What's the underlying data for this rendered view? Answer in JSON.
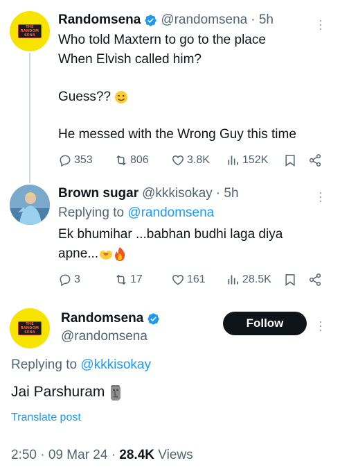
{
  "tweet1": {
    "name": "Randomsena",
    "handle": "@randomsena",
    "time": "· 5h",
    "avatar_text": [
      "THE",
      "RANDOM",
      "SENA"
    ],
    "lines": [
      "Who told Maxtern to go to the place",
      "When Elvish called him?",
      "",
      "Guess??",
      "",
      "He messed with the Wrong Guy this time"
    ],
    "emoji": "wink",
    "stats": {
      "replies": "353",
      "retweets": "806",
      "likes": "3.8K",
      "views": "152K"
    }
  },
  "tweet2": {
    "name": "Brown sugar",
    "handle": "@kkkisokay",
    "time": "· 5h",
    "replying_prefix": "Replying to ",
    "replying_to": "@randomsena",
    "line1": "Ek bhumihar ...babhan budhi laga diya",
    "line2": "apne...",
    "emojis": [
      "heart-hands",
      "fire"
    ],
    "stats": {
      "replies": "3",
      "retweets": "17",
      "likes": "161",
      "views": "28.5K"
    }
  },
  "main": {
    "name": "Randomsena",
    "handle": "@randomsena",
    "follow_label": "Follow",
    "replying_prefix": "Replying to ",
    "replying_to": "@kkkisokay",
    "text": "Jai Parshuram",
    "emoji": "moai",
    "translate_label": "Translate post",
    "time": "2:50 · 09 Mar 24 · ",
    "views_count": "28.4K",
    "views_label": " Views"
  },
  "colors": {
    "link": "#1d9bf0",
    "muted": "#536471",
    "verified": "#1d9bf0",
    "avatar_yellow": "#f7e300"
  }
}
